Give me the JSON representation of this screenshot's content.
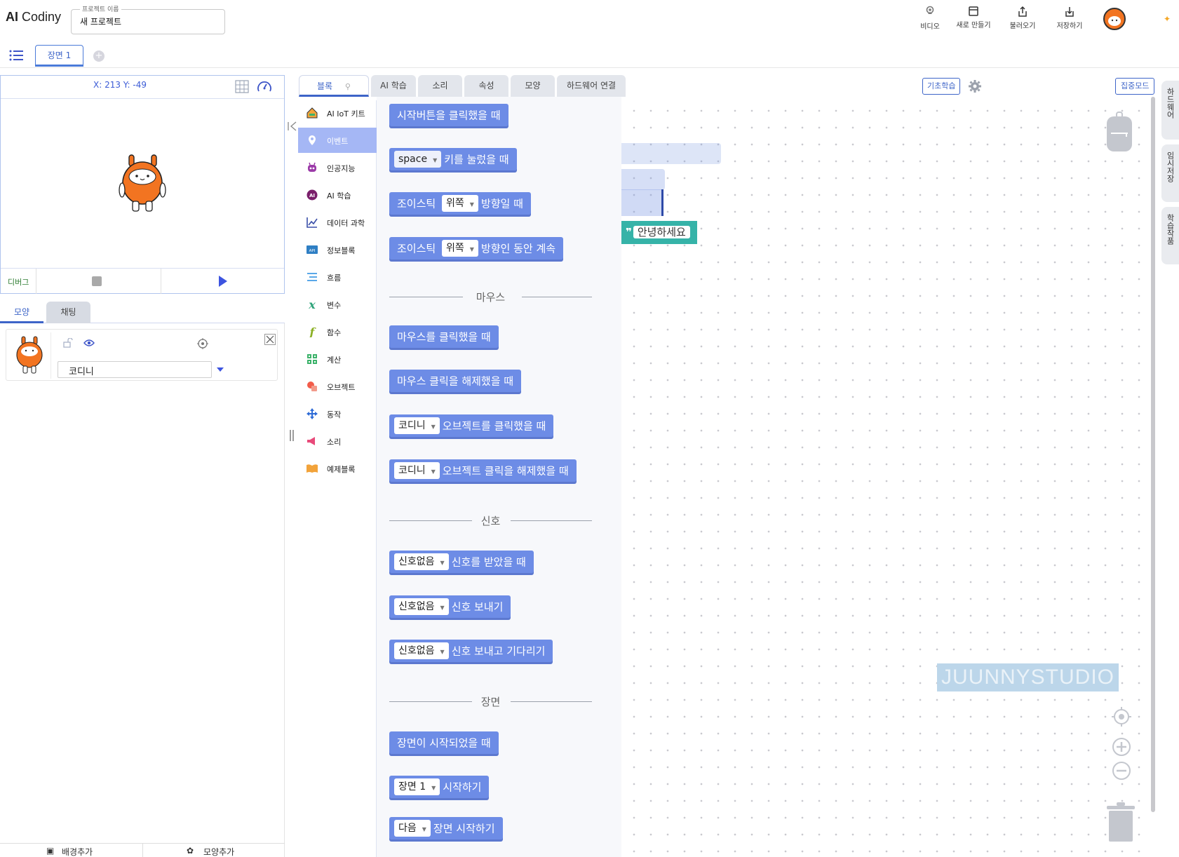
{
  "app": {
    "logo_bold": "AI",
    "logo_rest": " Codiny"
  },
  "project": {
    "label": "프로젝트 이름",
    "value": "새 프로젝트"
  },
  "header_buttons": {
    "video": "비디오",
    "new": "새로 만들기",
    "load": "불러오기",
    "save": "저장하기"
  },
  "scenes": {
    "tab": "장면 1"
  },
  "stage": {
    "coords": "X: 213 Y: -49",
    "debug": "디버그"
  },
  "object_tabs": {
    "shape": "모양",
    "chat": "채팅"
  },
  "object": {
    "name": "코디니"
  },
  "bottom": {
    "add_background": "배경추가",
    "add_shape": "모양추가"
  },
  "categories": [
    {
      "label": "AI IoT 키트"
    },
    {
      "label": "이벤트"
    },
    {
      "label": "인공지능"
    },
    {
      "label": "AI 학습"
    },
    {
      "label": "데이터 과학"
    },
    {
      "label": "정보블록"
    },
    {
      "label": "흐름"
    },
    {
      "label": "변수"
    },
    {
      "label": "함수"
    },
    {
      "label": "계산"
    },
    {
      "label": "오브젝트"
    },
    {
      "label": "동작"
    },
    {
      "label": "소리"
    },
    {
      "label": "예제블록"
    }
  ],
  "top_tabs": {
    "blocks": "블록",
    "ai": "AI 학습",
    "sound": "소리",
    "attr": "속성",
    "shape": "모양",
    "hw": "하드웨어 연결",
    "basic": "기초학습",
    "focus": "집중모드"
  },
  "blocks": {
    "start_click": "시작버튼을 클릭했을 때",
    "key_drop": "space",
    "key_text": "키를 눌렀을 때",
    "joy1_a": "조이스틱",
    "joy1_drop": "위쪽",
    "joy1_b": "방향일 때",
    "joy2_a": "조이스틱",
    "joy2_drop": "위쪽",
    "joy2_b": "방향인 동안 계속",
    "sec_mouse": "마우스",
    "mouse_click": "마우스를 클릭했을 때",
    "mouse_release": "마우스 클릭을 해제했을 때",
    "obj_click_drop": "코디니",
    "obj_click_text": "오브젝트를 클릭했을 때",
    "obj_release_drop": "코디니",
    "obj_release_text": "오브젝트 클릭을 해제했을 때",
    "sec_signal": "신호",
    "sig_recv_drop": "신호없음",
    "sig_recv_text": "신호를 받았을 때",
    "sig_send_drop": "신호없음",
    "sig_send_text": "신호 보내기",
    "sig_wait_drop": "신호없음",
    "sig_wait_text": "신호 보내고 기다리기",
    "sec_scene": "장면",
    "scene_start": "장면이 시작되었을 때",
    "scene_go_drop": "장면 1",
    "scene_go_text": "시작하기",
    "scene_next_drop": "다음",
    "scene_next_text": "장면 시작하기"
  },
  "workspace": {
    "green_text": "안녕하세요",
    "watermark": "JUUNNYSTUDIO"
  },
  "right_rail": {
    "hw": "하드웨어",
    "temp": "임시저장",
    "learn": "학습작품"
  },
  "colors": {
    "accent": "#3d64c8",
    "block": "#6d8ce6",
    "selected_category": "#a5b7f5",
    "green_block": "#36b3a8",
    "character": "#f27421"
  }
}
